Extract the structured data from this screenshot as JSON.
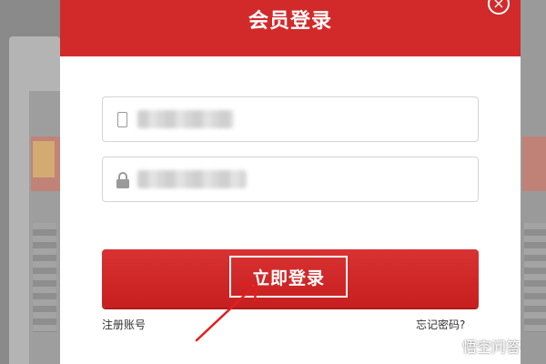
{
  "dialog": {
    "title": "会员登录",
    "close_label": "×"
  },
  "form": {
    "phone_icon": "phone-icon",
    "password_icon": "lock-icon"
  },
  "actions": {
    "login_label": "立即登录",
    "register_label": "注册账号",
    "forgot_label": "忘记密码?"
  },
  "watermark": {
    "text": "悟空问答"
  },
  "colors": {
    "brand_red": "#d22a2a",
    "annotation_red": "#e02020",
    "border": "#d4d4d4"
  }
}
